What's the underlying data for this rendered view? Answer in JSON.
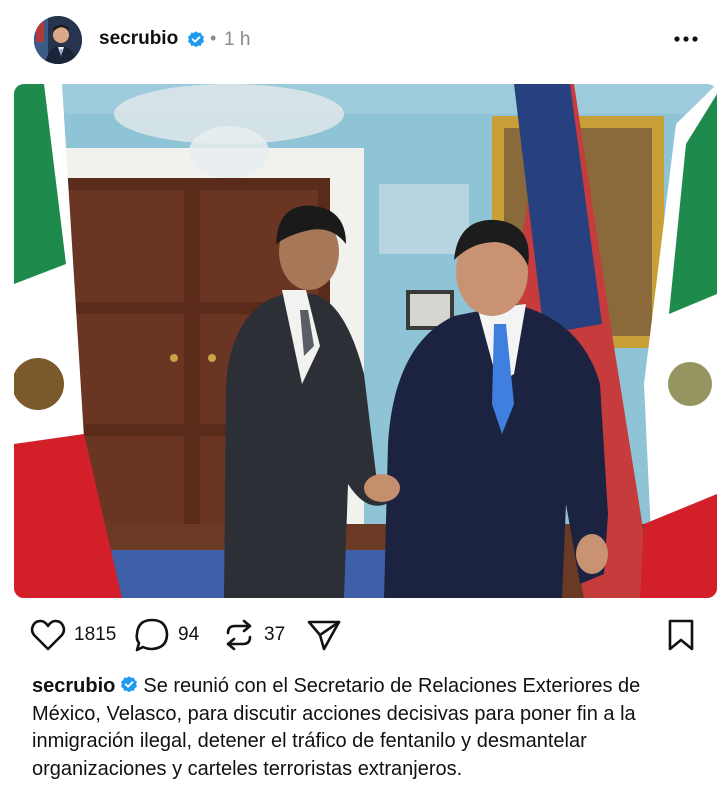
{
  "post": {
    "username": "secrubio",
    "time": "1 h",
    "dot": "•",
    "more_icon": "more-horizontal-icon",
    "verified_color": "#1d9bf0"
  },
  "actions": {
    "likes": "1815",
    "comments": "94",
    "reposts": "37"
  },
  "caption": {
    "username": "secrubio",
    "text": "Se reunió con el Secretario de Relaciones Exteriores de México, Velasco, para discutir acciones decisivas para poner fin a la inmigración ilegal, detener el tráfico de fentanilo y desmantelar organizaciones y carteles terroristas extranjeros."
  }
}
